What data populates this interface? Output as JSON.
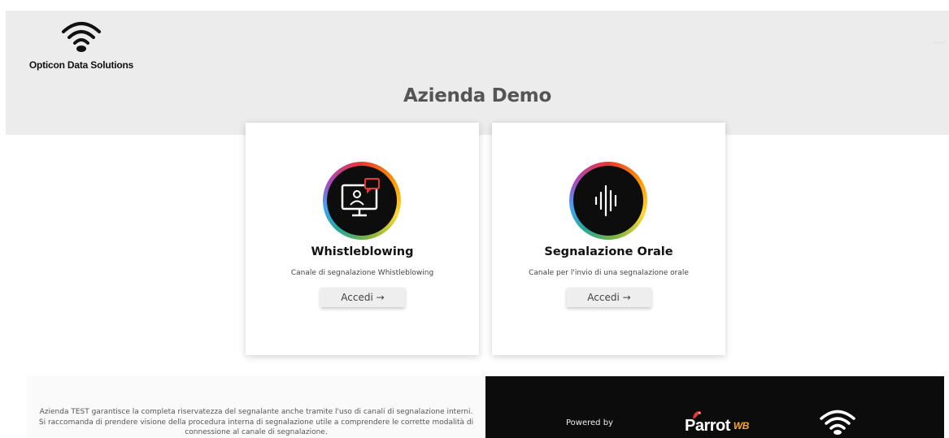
{
  "header": {
    "logo_text": "Opticon Data Solutions",
    "logo_icon": "wifi-icon",
    "company_title": "Azienda Demo"
  },
  "cards": [
    {
      "title": "Whistleblowing",
      "description": "Canale di segnalazione Whistleblowing",
      "button_label": "Accedi →",
      "icon": "computer-user-chat-icon"
    },
    {
      "title": "Segnalazione Orale",
      "description": "Canale per l'invio di una segnalazione orale",
      "button_label": "Accedi →",
      "icon": "sound-wave-icon"
    }
  ],
  "footer": {
    "disclaimer": "Azienda TEST garantisce la completa riservatezza del segnalante anche tramite l'uso di canali di segnalazione interni. Si raccomanda di prendere visione della procedura interna di segnalazione utile a comprendere le corrette modalità di connessione al canale di segnalazione.",
    "powered_by": "Powered by",
    "parrot_brand": "Parrot",
    "parrot_suffix": "WB",
    "footer_logo_icon": "wifi-icon"
  },
  "colors": {
    "header_bg": "#ececec",
    "title_color": "#555555",
    "footer_dark": "#0c0c0c",
    "button_bg": "#eeeeee"
  }
}
